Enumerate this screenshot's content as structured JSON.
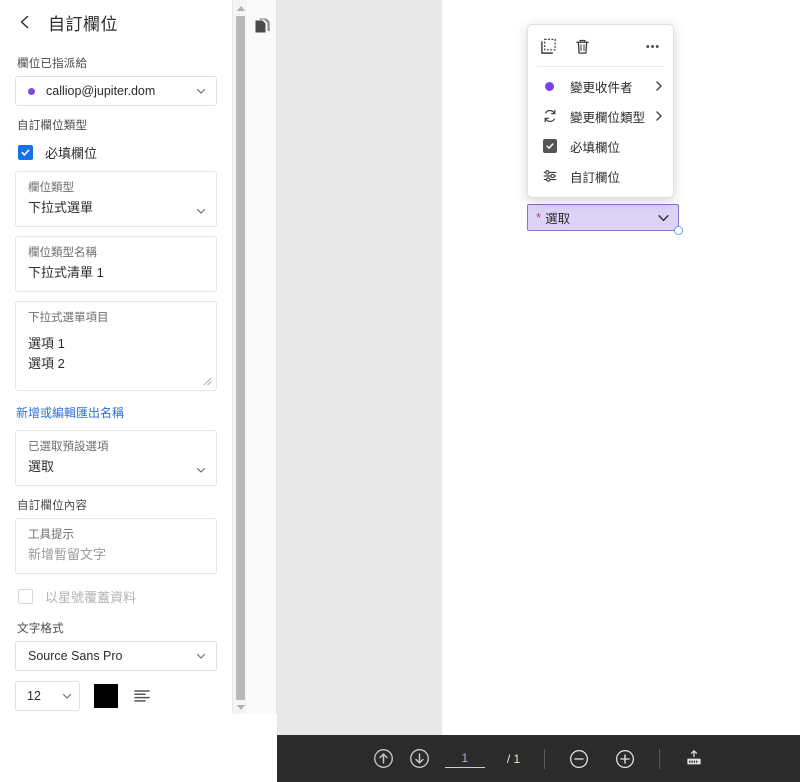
{
  "sidebar": {
    "back_icon": "chevron-left-icon",
    "title": "自訂欄位",
    "assigned_label": "欄位已指派給",
    "assignee": {
      "value": "calliop@jupiter.dom",
      "dot_color": "#7d4bd6",
      "chevron": "chevron-down-icon"
    },
    "type_section_label": "自訂欄位類型",
    "required_checkbox": {
      "label": "必填欄位",
      "checked": true
    },
    "field_type": {
      "label": "欄位類型",
      "value": "下拉式選單"
    },
    "field_name": {
      "label": "欄位類型名稱",
      "value": "下拉式清單 1"
    },
    "dropdown_items": {
      "label": "下拉式選單項目",
      "options": [
        "選項 1",
        "選項 2"
      ]
    },
    "export_link": "新增或編輯匯出名稱",
    "default_option": {
      "label": "已選取預設選項",
      "value": "選取"
    },
    "content_label": "自訂欄位內容",
    "tooltip": {
      "label": "工具提示",
      "placeholder": "新增暫留文字"
    },
    "mask_checkbox": {
      "label": "以星號覆蓋資料",
      "checked": false
    },
    "text_format_label": "文字格式",
    "font": {
      "value": "Source Sans Pro"
    },
    "font_size": {
      "value": "12"
    },
    "font_color": "#000000",
    "align_icon": "align-left-icon"
  },
  "toolstrip": {
    "pages_icon": "pages-copy-icon"
  },
  "context_menu": {
    "top_icons": [
      {
        "name": "duplicate-icon"
      },
      {
        "name": "delete-icon"
      },
      {
        "name": "more-options-icon"
      }
    ],
    "items": [
      {
        "label": "變更收件者",
        "icon": "purple-dot-icon",
        "has_submenu": true
      },
      {
        "label": "變更欄位類型",
        "icon": "refresh-icon",
        "has_submenu": true
      },
      {
        "label": "必填欄位",
        "icon": "checkbox-checked-icon",
        "has_submenu": false
      },
      {
        "label": "自訂欄位",
        "icon": "sliders-icon",
        "has_submenu": false
      }
    ]
  },
  "field_widget": {
    "required_mark": "*",
    "value": "選取",
    "chevron": "chevron-down-icon",
    "fill_color": "#ddd3f7",
    "border_color": "#8b6fd1",
    "required_color": "#d8353a"
  },
  "bottom_bar": {
    "prev_page_icon": "arrow-up-circle-icon",
    "next_page_icon": "arrow-down-circle-icon",
    "page_number": "1",
    "page_total": "/ 1",
    "zoom_out_icon": "minus-circle-icon",
    "zoom_in_icon": "plus-circle-icon",
    "fit_icon": "upload-keyboard-icon",
    "background": "#2b2b2b"
  }
}
